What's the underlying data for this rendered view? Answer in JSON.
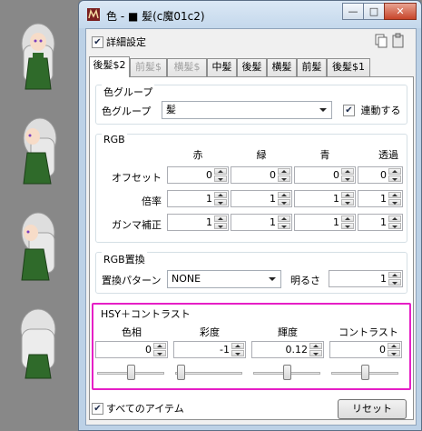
{
  "window": {
    "title": "色 - ■ 髪(c魔01c2)"
  },
  "titlebar_buttons": {
    "minimize": "—",
    "maximize": "□",
    "close": "✕"
  },
  "detail": {
    "label": "詳細設定",
    "checked": true
  },
  "tabs": [
    {
      "label": "後髪$2",
      "active": true,
      "enabled": true
    },
    {
      "label": "前髪$",
      "active": false,
      "enabled": false
    },
    {
      "label": "横髪$",
      "active": false,
      "enabled": false
    },
    {
      "label": "中髪",
      "active": false,
      "enabled": true
    },
    {
      "label": "後髪",
      "active": false,
      "enabled": true
    },
    {
      "label": "横髪",
      "active": false,
      "enabled": true
    },
    {
      "label": "前髪",
      "active": false,
      "enabled": true
    },
    {
      "label": "後髪$1",
      "active": false,
      "enabled": true
    }
  ],
  "color_group": {
    "title": "色グループ",
    "field_label": "色グループ",
    "value": "髪",
    "link_label": "連動する",
    "link_checked": true
  },
  "rgb": {
    "title": "RGB",
    "columns": [
      "赤",
      "緑",
      "青",
      "透過"
    ],
    "rows": [
      {
        "label": "オフセット",
        "values": [
          "0",
          "0",
          "0",
          "0"
        ]
      },
      {
        "label": "倍率",
        "values": [
          "1",
          "1",
          "1",
          "1"
        ]
      },
      {
        "label": "ガンマ補正",
        "values": [
          "1",
          "1",
          "1",
          "1"
        ]
      }
    ]
  },
  "replace": {
    "title": "RGB置換",
    "pattern_label": "置換パターン",
    "pattern_value": "NONE",
    "brightness_label": "明るさ",
    "brightness_value": "1"
  },
  "hsy": {
    "title": "HSY＋コントラスト",
    "columns": [
      "色相",
      "彩度",
      "輝度",
      "コントラスト"
    ],
    "values": [
      "0",
      "-1",
      "0.12",
      "0"
    ],
    "slider_levels": [
      0.5,
      0.08,
      0.5,
      0.5
    ]
  },
  "footer": {
    "all_items_label": "すべてのアイテム",
    "all_items_checked": true,
    "reset_label": "リセット"
  },
  "colors": {
    "highlight": "#e61fc6",
    "window_frame": "#bcd1e6"
  }
}
